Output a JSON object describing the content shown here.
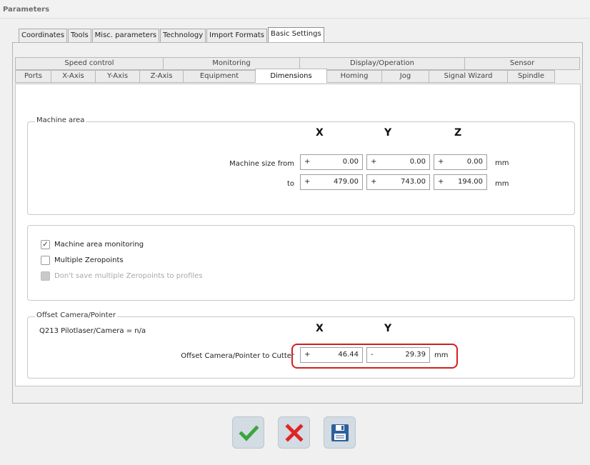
{
  "window": {
    "title": "Parameters"
  },
  "top_tabs": [
    {
      "label": "Coordinates",
      "active": false
    },
    {
      "label": "Tools",
      "active": false
    },
    {
      "label": "Misc. parameters",
      "active": false
    },
    {
      "label": "Technology",
      "active": false
    },
    {
      "label": "Import Formats",
      "active": false
    },
    {
      "label": "Basic Settings",
      "active": true
    }
  ],
  "group_tabs": [
    "Speed control",
    "Monitoring",
    "Display/Operation",
    "Sensor"
  ],
  "sub_tabs": [
    "Ports",
    "X-Axis",
    "Y-Axis",
    "Z-Axis",
    "Equipment",
    "Dimensions",
    "Homing",
    "Jog",
    "Signal Wizard",
    "Spindle"
  ],
  "active_sub_tab": "Dimensions",
  "machine_area": {
    "title": "Machine area",
    "axes": [
      "X",
      "Y",
      "Z"
    ],
    "from_label": "Machine size from",
    "to_label": "to",
    "unit": "mm",
    "from_values": [
      {
        "sign": "+",
        "value": "0.00"
      },
      {
        "sign": "+",
        "value": "0.00"
      },
      {
        "sign": "+",
        "value": "0.00"
      }
    ],
    "to_values": [
      {
        "sign": "+",
        "value": "479.00"
      },
      {
        "sign": "+",
        "value": "743.00"
      },
      {
        "sign": "+",
        "value": "194.00"
      }
    ]
  },
  "monitoring": {
    "options": [
      {
        "label": "Machine area monitoring",
        "checked": true,
        "disabled": false
      },
      {
        "label": "Multiple Zeropoints",
        "checked": false,
        "disabled": false
      },
      {
        "label": "Don't save multiple Zeropoints to profiles",
        "checked": false,
        "disabled": true
      }
    ]
  },
  "offset": {
    "title": "Offset Camera/Pointer",
    "q_label": "Q213 Pilotlaser/Camera = n/a",
    "axes": [
      "X",
      "Y"
    ],
    "row_label": "Offset Camera/Pointer to Cutter",
    "values": [
      {
        "sign": "+",
        "value": "46.44"
      },
      {
        "sign": "-",
        "value": "29.39"
      }
    ],
    "unit": "mm"
  },
  "buttons": {
    "ok": "checkmark-icon",
    "cancel": "close-icon",
    "save": "save-icon"
  },
  "colors": {
    "accent_green": "#3aa63a",
    "cancel_red": "#e02424",
    "save_blue": "#2f5f9a",
    "highlight_red": "#d02020"
  }
}
